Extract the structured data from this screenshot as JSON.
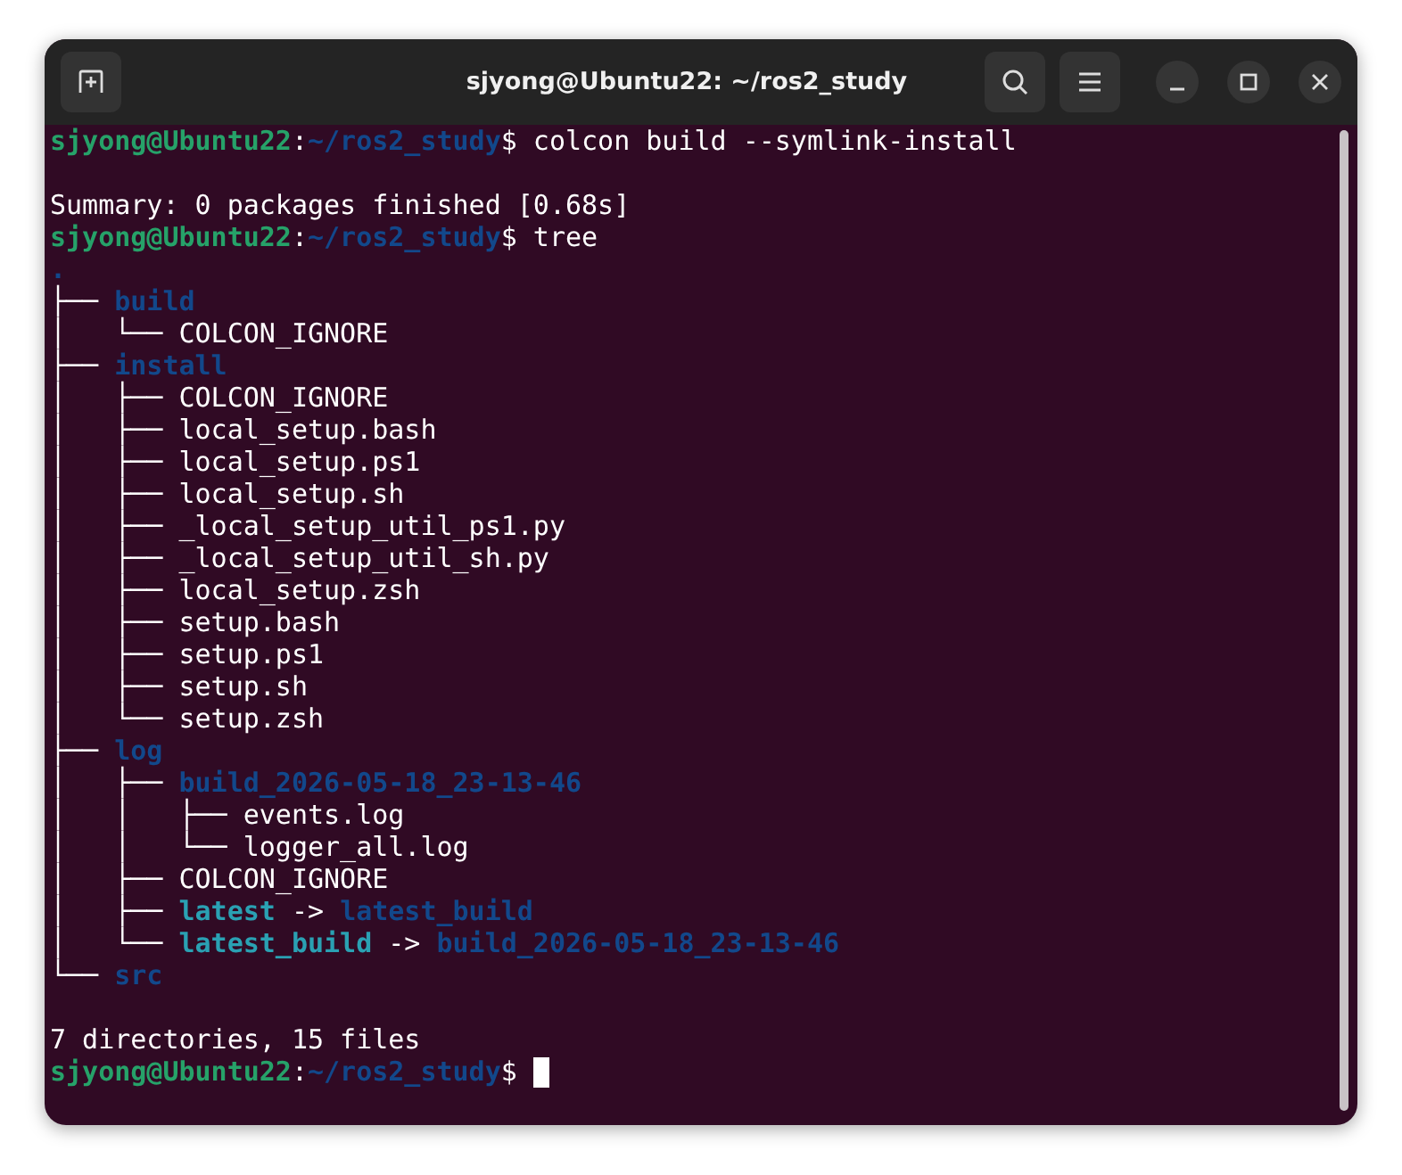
{
  "window": {
    "title": "sjyong@Ubuntu22: ~/ros2_study"
  },
  "terminal": {
    "cursor": true,
    "lines": [
      {
        "kind": "text",
        "segments": [
          {
            "kind": "user",
            "text": "sjyong@Ubuntu22"
          },
          {
            "kind": "plain",
            "text": ":"
          },
          {
            "kind": "path",
            "text": "~/ros2_study"
          },
          {
            "kind": "plain",
            "text": "$ colcon build --symlink-install"
          }
        ]
      },
      {
        "kind": "blank"
      },
      {
        "kind": "text",
        "segments": [
          {
            "kind": "plain",
            "text": "Summary: 0 packages finished [0.68s]"
          }
        ]
      },
      {
        "kind": "text",
        "segments": [
          {
            "kind": "user",
            "text": "sjyong@Ubuntu22"
          },
          {
            "kind": "plain",
            "text": ":"
          },
          {
            "kind": "path",
            "text": "~/ros2_study"
          },
          {
            "kind": "plain",
            "text": "$ tree"
          }
        ]
      },
      {
        "kind": "text",
        "segments": [
          {
            "kind": "dir",
            "text": "."
          }
        ]
      },
      {
        "kind": "text",
        "segments": [
          {
            "kind": "branch",
            "text": "├── "
          },
          {
            "kind": "dir",
            "text": "build"
          }
        ]
      },
      {
        "kind": "text",
        "segments": [
          {
            "kind": "branch",
            "text": "│   └── "
          },
          {
            "kind": "plain",
            "text": "COLCON_IGNORE"
          }
        ]
      },
      {
        "kind": "text",
        "segments": [
          {
            "kind": "branch",
            "text": "├── "
          },
          {
            "kind": "dir",
            "text": "install"
          }
        ]
      },
      {
        "kind": "text",
        "segments": [
          {
            "kind": "branch",
            "text": "│   ├── "
          },
          {
            "kind": "plain",
            "text": "COLCON_IGNORE"
          }
        ]
      },
      {
        "kind": "text",
        "segments": [
          {
            "kind": "branch",
            "text": "│   ├── "
          },
          {
            "kind": "plain",
            "text": "local_setup.bash"
          }
        ]
      },
      {
        "kind": "text",
        "segments": [
          {
            "kind": "branch",
            "text": "│   ├── "
          },
          {
            "kind": "plain",
            "text": "local_setup.ps1"
          }
        ]
      },
      {
        "kind": "text",
        "segments": [
          {
            "kind": "branch",
            "text": "│   ├── "
          },
          {
            "kind": "plain",
            "text": "local_setup.sh"
          }
        ]
      },
      {
        "kind": "text",
        "segments": [
          {
            "kind": "branch",
            "text": "│   ├── "
          },
          {
            "kind": "plain",
            "text": "_local_setup_util_ps1.py"
          }
        ]
      },
      {
        "kind": "text",
        "segments": [
          {
            "kind": "branch",
            "text": "│   ├── "
          },
          {
            "kind": "plain",
            "text": "_local_setup_util_sh.py"
          }
        ]
      },
      {
        "kind": "text",
        "segments": [
          {
            "kind": "branch",
            "text": "│   ├── "
          },
          {
            "kind": "plain",
            "text": "local_setup.zsh"
          }
        ]
      },
      {
        "kind": "text",
        "segments": [
          {
            "kind": "branch",
            "text": "│   ├── "
          },
          {
            "kind": "plain",
            "text": "setup.bash"
          }
        ]
      },
      {
        "kind": "text",
        "segments": [
          {
            "kind": "branch",
            "text": "│   ├── "
          },
          {
            "kind": "plain",
            "text": "setup.ps1"
          }
        ]
      },
      {
        "kind": "text",
        "segments": [
          {
            "kind": "branch",
            "text": "│   ├── "
          },
          {
            "kind": "plain",
            "text": "setup.sh"
          }
        ]
      },
      {
        "kind": "text",
        "segments": [
          {
            "kind": "branch",
            "text": "│   └── "
          },
          {
            "kind": "plain",
            "text": "setup.zsh"
          }
        ]
      },
      {
        "kind": "text",
        "segments": [
          {
            "kind": "branch",
            "text": "├── "
          },
          {
            "kind": "dir",
            "text": "log"
          }
        ]
      },
      {
        "kind": "text",
        "segments": [
          {
            "kind": "branch",
            "text": "│   ├── "
          },
          {
            "kind": "dir",
            "text": "build_2026-05-18_23-13-46"
          }
        ]
      },
      {
        "kind": "text",
        "segments": [
          {
            "kind": "branch",
            "text": "│   │   ├── "
          },
          {
            "kind": "plain",
            "text": "events.log"
          }
        ]
      },
      {
        "kind": "text",
        "segments": [
          {
            "kind": "branch",
            "text": "│   │   └── "
          },
          {
            "kind": "plain",
            "text": "logger_all.log"
          }
        ]
      },
      {
        "kind": "text",
        "segments": [
          {
            "kind": "branch",
            "text": "│   ├── "
          },
          {
            "kind": "plain",
            "text": "COLCON_IGNORE"
          }
        ]
      },
      {
        "kind": "text",
        "segments": [
          {
            "kind": "branch",
            "text": "│   ├── "
          },
          {
            "kind": "link",
            "text": "latest"
          },
          {
            "kind": "plain",
            "text": " -> "
          },
          {
            "kind": "dir",
            "text": "latest_build"
          }
        ]
      },
      {
        "kind": "text",
        "segments": [
          {
            "kind": "branch",
            "text": "│   └── "
          },
          {
            "kind": "link",
            "text": "latest_build"
          },
          {
            "kind": "plain",
            "text": " -> "
          },
          {
            "kind": "dir",
            "text": "build_2026-05-18_23-13-46"
          }
        ]
      },
      {
        "kind": "text",
        "segments": [
          {
            "kind": "branch",
            "text": "└── "
          },
          {
            "kind": "dir",
            "text": "src"
          }
        ]
      },
      {
        "kind": "blank"
      },
      {
        "kind": "text",
        "segments": [
          {
            "kind": "plain",
            "text": "7 directories, 15 files"
          }
        ]
      },
      {
        "kind": "text",
        "segments": [
          {
            "kind": "user",
            "text": "sjyong@Ubuntu22"
          },
          {
            "kind": "plain",
            "text": ":"
          },
          {
            "kind": "path",
            "text": "~/ros2_study"
          },
          {
            "kind": "plain",
            "text": "$ "
          }
        ]
      }
    ]
  }
}
